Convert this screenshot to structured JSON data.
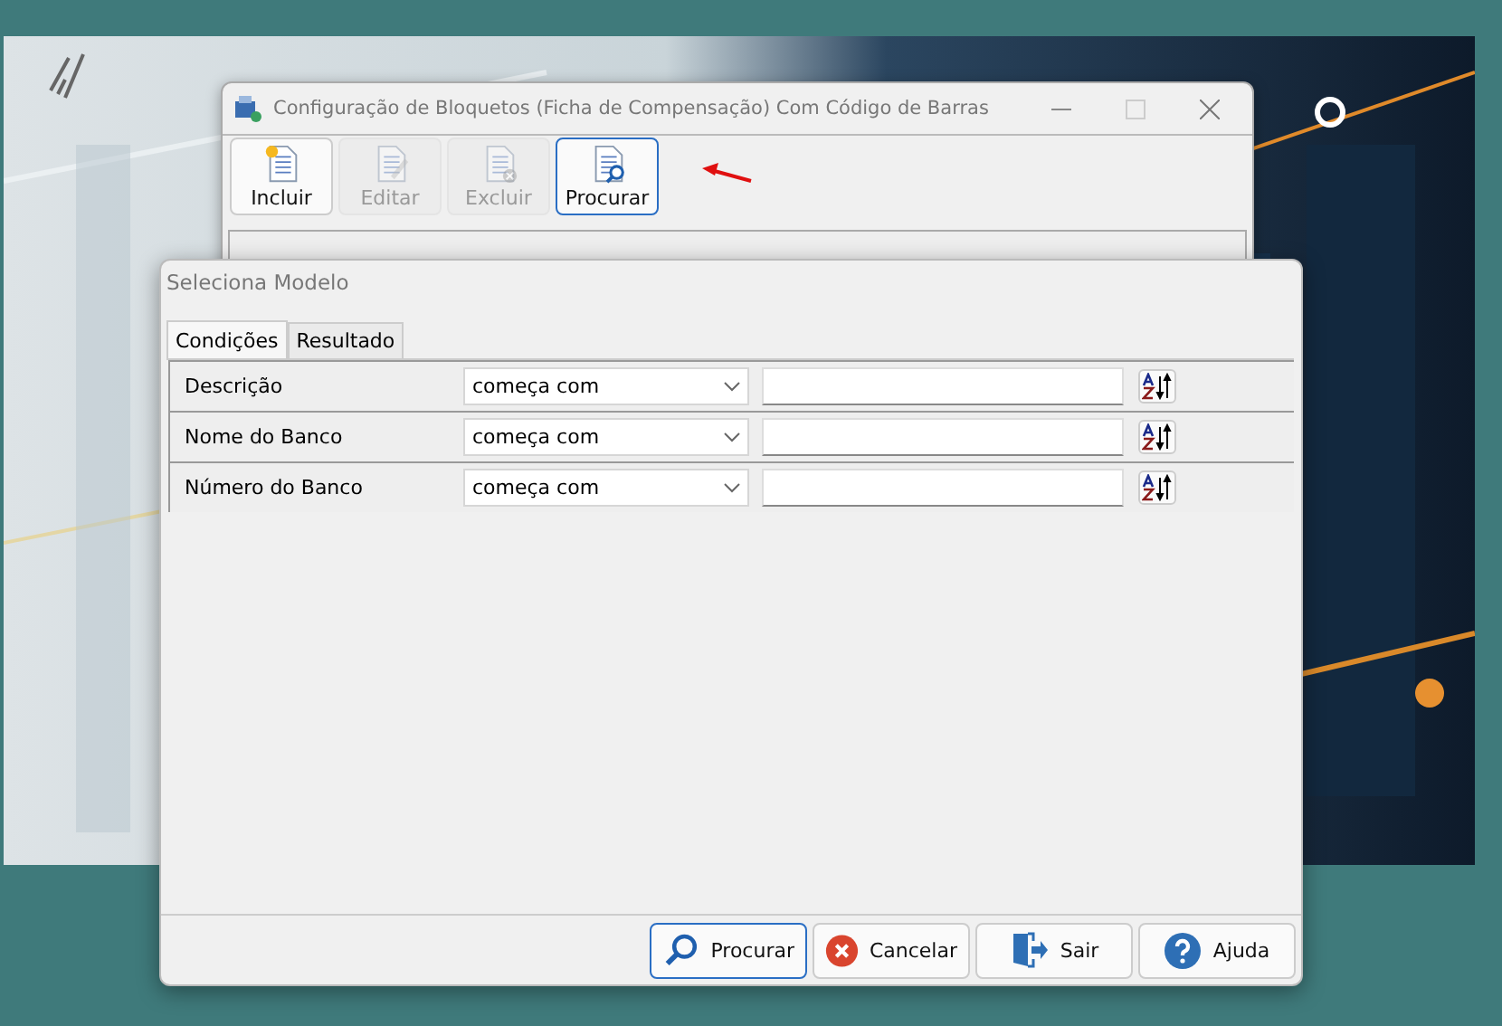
{
  "main_window": {
    "title": "Configuração de Bloquetos (Ficha de Compensação) Com Código de Barras",
    "toolbar": [
      {
        "label": "Incluir",
        "kind": "new",
        "disabled": false,
        "focused": false
      },
      {
        "label": "Editar",
        "kind": "edit",
        "disabled": true,
        "focused": false
      },
      {
        "label": "Excluir",
        "kind": "delete",
        "disabled": true,
        "focused": false
      },
      {
        "label": "Procurar",
        "kind": "search",
        "disabled": false,
        "focused": true
      }
    ]
  },
  "dialog": {
    "title": "Seleciona Modelo",
    "tabs": [
      {
        "label": "Condições",
        "selected": true
      },
      {
        "label": "Resultado",
        "selected": false
      }
    ],
    "conditions": [
      {
        "field": "Descrição",
        "operator": "começa com"
      },
      {
        "field": "Nome do Banco",
        "operator": "começa com"
      },
      {
        "field": "Número do Banco",
        "operator": "começa com"
      }
    ],
    "buttons": [
      {
        "label": "Procurar",
        "kind": "search",
        "focused": true
      },
      {
        "label": "Cancelar",
        "kind": "cancel",
        "focused": false
      },
      {
        "label": "Sair",
        "kind": "exit",
        "focused": false
      },
      {
        "label": "Ajuda",
        "kind": "help",
        "focused": false
      }
    ]
  }
}
